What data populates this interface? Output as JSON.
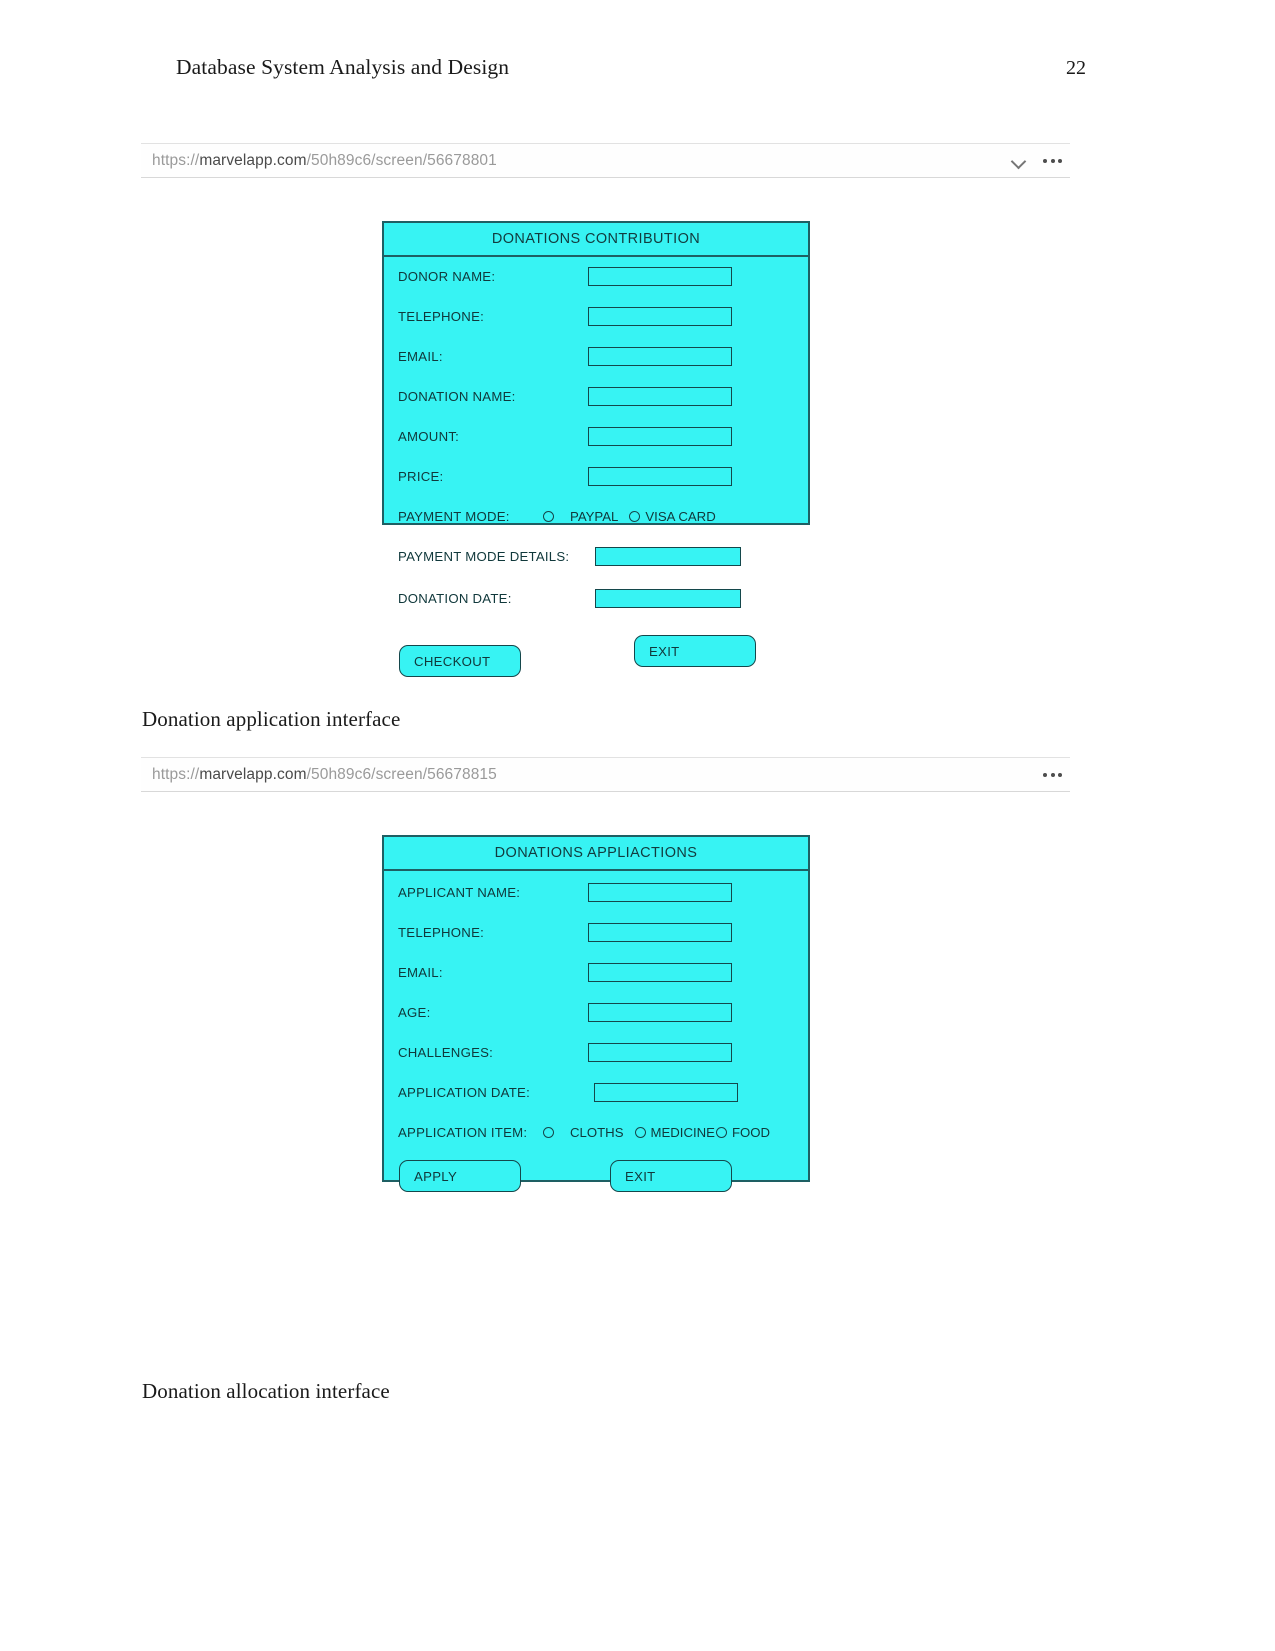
{
  "header": {
    "document_title": "Database System Analysis and Design",
    "page_number": "22"
  },
  "figures": [
    {
      "browser": {
        "url_scheme": "https://",
        "url_host": "marvelapp.com",
        "url_path": "/50h89c6/screen/56678801",
        "url_full": "https://marvelapp.com/50h89c6/screen/56678801",
        "chevron_icon": "chevron-down-icon",
        "menu_icon": "more-options-icon"
      },
      "mockup": {
        "title": "DONATIONS CONTRIBUTION",
        "fields": [
          {
            "label": "DONOR NAME:",
            "value": ""
          },
          {
            "label": "TELEPHONE:",
            "value": ""
          },
          {
            "label": "EMAIL:",
            "value": ""
          },
          {
            "label": "DONATION NAME:",
            "value": ""
          },
          {
            "label": "AMOUNT:",
            "value": ""
          },
          {
            "label": "PRICE:",
            "value": ""
          }
        ],
        "radio_row": {
          "label": "PAYMENT MODE:",
          "options": [
            "PAYPAL",
            "VISA CARD"
          ]
        },
        "wide_fields": [
          {
            "label": "PAYMENT MODE DETAILS:",
            "value": ""
          },
          {
            "label": "DONATION DATE:",
            "value": ""
          }
        ],
        "buttons": [
          {
            "label": "CHECKOUT"
          },
          {
            "label": "EXIT"
          }
        ]
      },
      "caption": "Donation application interface"
    },
    {
      "browser": {
        "url_scheme": "https://",
        "url_host": "marvelapp.com",
        "url_path": "/50h89c6/screen/56678815",
        "url_full": "https://marvelapp.com/50h89c6/screen/56678815",
        "menu_icon": "more-options-icon"
      },
      "mockup": {
        "title": "DONATIONS APPLIACTIONS",
        "fields": [
          {
            "label": "APPLICANT NAME:",
            "value": ""
          },
          {
            "label": "TELEPHONE:",
            "value": ""
          },
          {
            "label": "EMAIL:",
            "value": ""
          },
          {
            "label": "AGE:",
            "value": ""
          },
          {
            "label": "CHALLENGES:",
            "value": ""
          },
          {
            "label": "APPLICATION DATE:",
            "value": ""
          }
        ],
        "radio_row": {
          "label": "APPLICATION ITEM:",
          "options": [
            "CLOTHS",
            "MEDICINE",
            "FOOD"
          ]
        },
        "buttons": [
          {
            "label": "APPLY"
          },
          {
            "label": "EXIT"
          }
        ]
      },
      "caption": "Donation allocation interface"
    }
  ],
  "colors": {
    "mockup_fill": "#37f3f3",
    "mockup_stroke": "#14474b",
    "url_text": "#9a9a9a",
    "url_host": "#4a4a4a"
  }
}
